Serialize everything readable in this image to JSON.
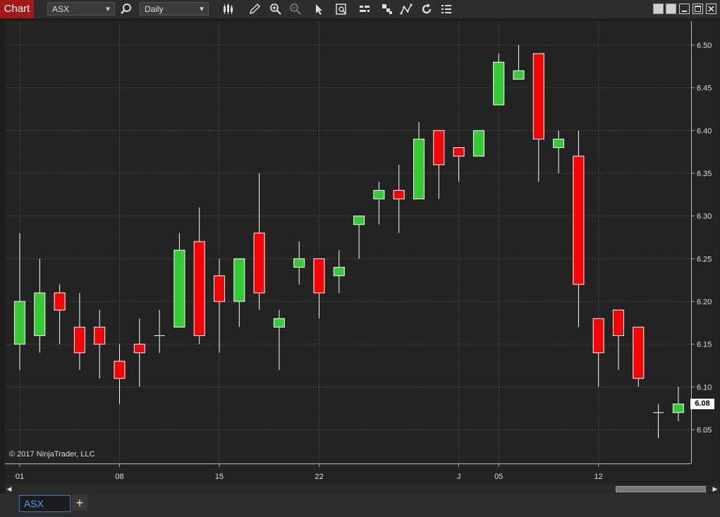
{
  "toolbar": {
    "chart_label": "Chart",
    "instrument": "ASX",
    "interval": "Daily",
    "icons": [
      "search-icon",
      "bar-type-icon",
      "pencil-icon",
      "zoom-in-icon",
      "zoom-out-icon",
      "pointer-icon",
      "data-box-icon",
      "strategies-icon",
      "indicators-icon",
      "drawing-tools-icon",
      "reload-icon",
      "properties-icon"
    ]
  },
  "copyright": "© 2017 NinjaTrader, LLC",
  "price_marker": "6.08",
  "sheet_tab": "ASX",
  "add_tab": "+",
  "colors": {
    "up": "#33cc33",
    "down": "#ff0000",
    "background": "#232323",
    "grid": "#4a4a4a"
  },
  "chart_data": {
    "type": "candlestick",
    "ylim": [
      6.02,
      6.52
    ],
    "y_ticks": [
      "6.05",
      "6.10",
      "6.15",
      "6.20",
      "6.25",
      "6.30",
      "6.35",
      "6.40",
      "6.45",
      "6.50"
    ],
    "x_labels": [
      {
        "label": "01",
        "bar": 0
      },
      {
        "label": "08",
        "bar": 5
      },
      {
        "label": "15",
        "bar": 10
      },
      {
        "label": "22",
        "bar": 15
      },
      {
        "label": "J",
        "bar": 22
      },
      {
        "label": "05",
        "bar": 24
      },
      {
        "label": "12",
        "bar": 29
      }
    ],
    "candles": [
      {
        "o": 6.15,
        "h": 6.28,
        "l": 6.12,
        "c": 6.2
      },
      {
        "o": 6.16,
        "h": 6.25,
        "l": 6.14,
        "c": 6.21
      },
      {
        "o": 6.21,
        "h": 6.22,
        "l": 6.15,
        "c": 6.19
      },
      {
        "o": 6.17,
        "h": 6.21,
        "l": 6.12,
        "c": 6.14
      },
      {
        "o": 6.17,
        "h": 6.19,
        "l": 6.11,
        "c": 6.15
      },
      {
        "o": 6.13,
        "h": 6.15,
        "l": 6.08,
        "c": 6.11
      },
      {
        "o": 6.15,
        "h": 6.18,
        "l": 6.1,
        "c": 6.14
      },
      {
        "o": 6.16,
        "h": 6.19,
        "l": 6.14,
        "c": 6.16
      },
      {
        "o": 6.17,
        "h": 6.28,
        "l": 6.17,
        "c": 6.26
      },
      {
        "o": 6.27,
        "h": 6.31,
        "l": 6.15,
        "c": 6.16
      },
      {
        "o": 6.23,
        "h": 6.25,
        "l": 6.14,
        "c": 6.2
      },
      {
        "o": 6.2,
        "h": 6.25,
        "l": 6.17,
        "c": 6.25
      },
      {
        "o": 6.28,
        "h": 6.35,
        "l": 6.19,
        "c": 6.21
      },
      {
        "o": 6.17,
        "h": 6.19,
        "l": 6.12,
        "c": 6.18
      },
      {
        "o": 6.24,
        "h": 6.27,
        "l": 6.22,
        "c": 6.25
      },
      {
        "o": 6.25,
        "h": 6.25,
        "l": 6.18,
        "c": 6.21
      },
      {
        "o": 6.23,
        "h": 6.26,
        "l": 6.21,
        "c": 6.24
      },
      {
        "o": 6.29,
        "h": 6.3,
        "l": 6.25,
        "c": 6.3
      },
      {
        "o": 6.32,
        "h": 6.34,
        "l": 6.29,
        "c": 6.33
      },
      {
        "o": 6.33,
        "h": 6.36,
        "l": 6.28,
        "c": 6.32
      },
      {
        "o": 6.32,
        "h": 6.41,
        "l": 6.32,
        "c": 6.39
      },
      {
        "o": 6.4,
        "h": 6.4,
        "l": 6.32,
        "c": 6.36
      },
      {
        "o": 6.38,
        "h": 6.38,
        "l": 6.34,
        "c": 6.37
      },
      {
        "o": 6.37,
        "h": 6.4,
        "l": 6.37,
        "c": 6.4
      },
      {
        "o": 6.43,
        "h": 6.49,
        "l": 6.43,
        "c": 6.48
      },
      {
        "o": 6.46,
        "h": 6.5,
        "l": 6.46,
        "c": 6.47
      },
      {
        "o": 6.49,
        "h": 6.49,
        "l": 6.34,
        "c": 6.39
      },
      {
        "o": 6.38,
        "h": 6.4,
        "l": 6.35,
        "c": 6.39
      },
      {
        "o": 6.37,
        "h": 6.4,
        "l": 6.17,
        "c": 6.22
      },
      {
        "o": 6.18,
        "h": 6.18,
        "l": 6.1,
        "c": 6.14
      },
      {
        "o": 6.19,
        "h": 6.19,
        "l": 6.12,
        "c": 6.16
      },
      {
        "o": 6.17,
        "h": 6.17,
        "l": 6.1,
        "c": 6.11
      },
      {
        "o": 6.07,
        "h": 6.08,
        "l": 6.04,
        "c": 6.07
      },
      {
        "o": 6.07,
        "h": 6.1,
        "l": 6.06,
        "c": 6.08
      }
    ]
  }
}
